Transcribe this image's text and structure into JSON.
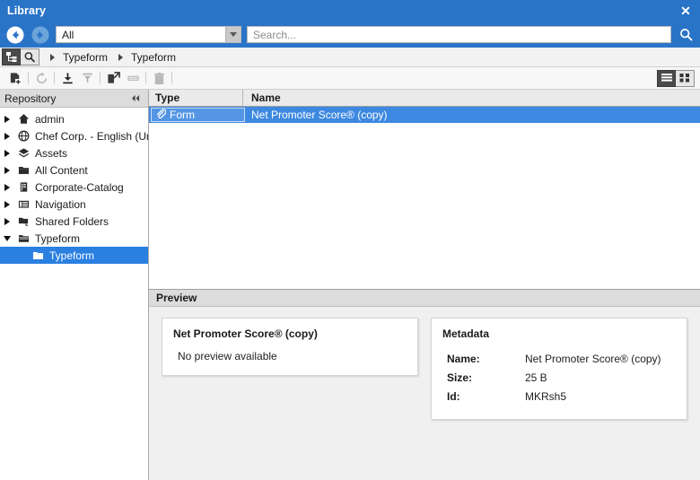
{
  "window": {
    "title": "Library",
    "close_label": "✕",
    "accent_color": "#2a74c7",
    "selection_color": "#3d88e0"
  },
  "searchbar": {
    "back_icon": "back-arrow-icon",
    "forward_icon": "forward-arrow-icon",
    "filter_value": "All",
    "search_value": "",
    "search_placeholder": "Search...",
    "search_icon": "search-icon"
  },
  "breadcrumb": {
    "tree_toggle_icon": "tree-view-icon",
    "search_toggle_icon": "search-icon",
    "items": [
      {
        "label": "Typeform"
      },
      {
        "label": "Typeform"
      }
    ]
  },
  "toolbar": {
    "buttons": [
      {
        "name": "new-document-button",
        "icon": "new-document-icon",
        "enabled": true
      },
      {
        "name": "refresh-button",
        "icon": "refresh-icon",
        "enabled": false
      },
      {
        "name": "download-button",
        "icon": "download-icon",
        "enabled": true
      },
      {
        "name": "upload-button",
        "icon": "upload-icon",
        "enabled": false
      },
      {
        "name": "open-external-button",
        "icon": "open-external-icon",
        "enabled": true
      },
      {
        "name": "rename-button",
        "icon": "rename-icon",
        "enabled": false
      },
      {
        "name": "delete-button",
        "icon": "trash-icon",
        "enabled": false
      }
    ],
    "view_list_label": "list-view-icon",
    "view_grid_label": "grid-view-icon",
    "view_selected": "list"
  },
  "sidebar": {
    "header": "Repository",
    "collapse_icon": "collapse-left-icon",
    "items": [
      {
        "label": "admin",
        "icon": "home-icon",
        "expanded": false,
        "indent": 0,
        "selected": false
      },
      {
        "label": "Chef Corp. - English (United",
        "icon": "globe-icon",
        "expanded": false,
        "indent": 0,
        "selected": false
      },
      {
        "label": "Assets",
        "icon": "assets-layers-icon",
        "expanded": false,
        "indent": 0,
        "selected": false
      },
      {
        "label": "All Content",
        "icon": "folder-icon",
        "expanded": false,
        "indent": 0,
        "selected": false
      },
      {
        "label": "Corporate-Catalog",
        "icon": "catalog-book-icon",
        "expanded": false,
        "indent": 0,
        "selected": false
      },
      {
        "label": "Navigation",
        "icon": "navigation-list-icon",
        "expanded": false,
        "indent": 0,
        "selected": false
      },
      {
        "label": "Shared Folders",
        "icon": "shared-folder-icon",
        "expanded": false,
        "indent": 0,
        "selected": false
      },
      {
        "label": "Typeform",
        "icon": "folder-open-icon",
        "expanded": true,
        "indent": 0,
        "selected": false
      },
      {
        "label": "Typeform",
        "icon": "folder-icon",
        "expanded": null,
        "indent": 1,
        "selected": true
      }
    ]
  },
  "filelist": {
    "columns": [
      "Type",
      "Name"
    ],
    "rows": [
      {
        "type": "Form",
        "type_icon": "form-attachment-icon",
        "name": "Net Promoter Score® (copy)",
        "selected": true
      }
    ]
  },
  "preview": {
    "header": "Preview",
    "document": {
      "title": "Net Promoter Score® (copy)",
      "message": "No preview available"
    },
    "metadata": {
      "title": "Metadata",
      "fields": [
        {
          "key": "Name:",
          "value": "Net Promoter Score® (copy)"
        },
        {
          "key": "Size:",
          "value": "25 B"
        },
        {
          "key": "Id:",
          "value": "MKRsh5"
        }
      ]
    }
  }
}
